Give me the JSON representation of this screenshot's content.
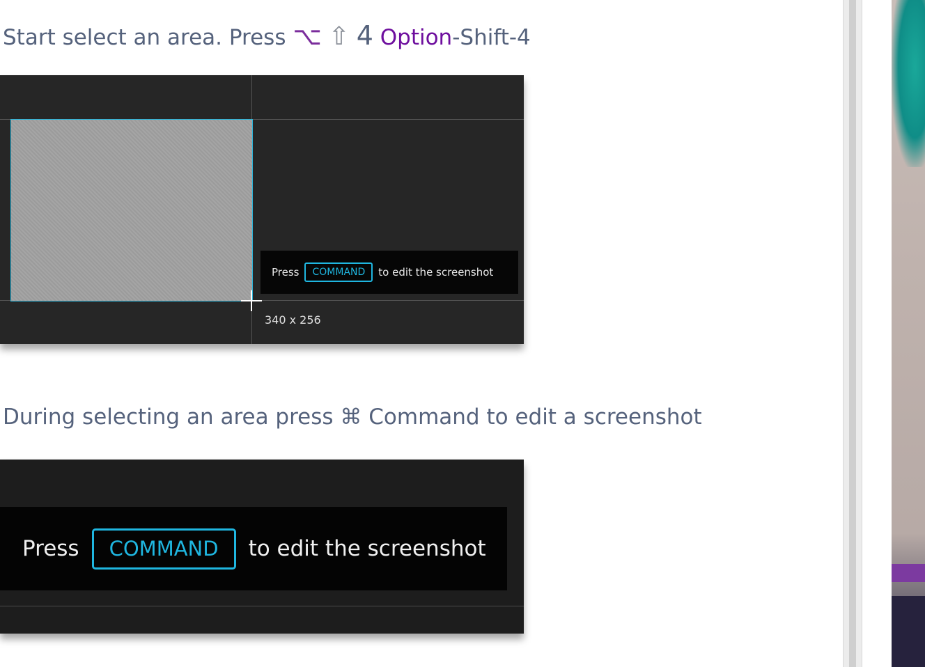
{
  "step1": {
    "text": "Start select an area. Press",
    "keys": {
      "option_glyph": "⌥",
      "shift_glyph": "⇧",
      "digit": "4"
    },
    "option_link": "Option",
    "suffix": "-Shift-4"
  },
  "screenshot1": {
    "hint_press": "Press",
    "hint_command": "COMMAND",
    "hint_after": "to edit the screenshot",
    "size_label": "340 x 256"
  },
  "step2": {
    "text_before": "During selecting an area press",
    "cmd_glyph": "⌘",
    "text_after": "Command to edit a screenshot"
  },
  "screenshot2": {
    "hint_press": "Press",
    "hint_command": "COMMAND",
    "hint_after": "to edit the screenshot"
  },
  "colors": {
    "text": "#55627c",
    "link": "#6e0f9e",
    "accent": "#1fb6e0"
  }
}
